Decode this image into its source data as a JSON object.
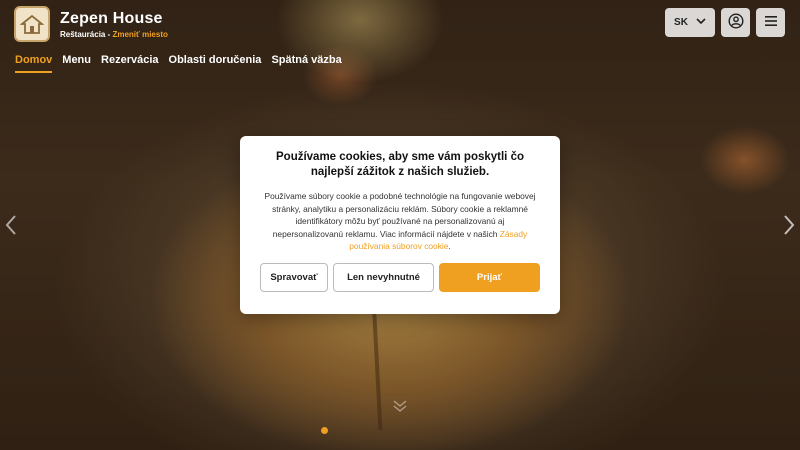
{
  "brand": {
    "name": "Zepen House",
    "subtitle": "Reštaurácia",
    "separator": " - ",
    "change_city": "Zmeniť miesto",
    "logo_icon": "house-logo-icon"
  },
  "nav": {
    "items": [
      {
        "label": "Domov",
        "active": true
      },
      {
        "label": "Menu",
        "active": false
      },
      {
        "label": "Rezervácia",
        "active": false
      },
      {
        "label": "Oblasti doručenia",
        "active": false
      },
      {
        "label": "Spätná väzba",
        "active": false
      }
    ]
  },
  "header_actions": {
    "language": "SK",
    "language_icon": "chevron-down-icon",
    "account_icon": "user-icon",
    "menu_icon": "hamburger-icon"
  },
  "cookie_modal": {
    "title": "Používame cookies, aby sme vám poskytli čo najlepší zážitok z našich služieb.",
    "body": "Používame súbory cookie a podobné technológie na fungovanie webovej stránky, analytiku a personalizáciu reklám. Súbory cookie a reklamné identifikátory môžu byť používané na personalizovanú aj nepersonalizovanú reklamu. Viac informácií nájdete v našich ",
    "link": "Zásady používania súborov cookie",
    "link_suffix": ".",
    "buttons": {
      "manage": "Spravovať",
      "necessary": "Len nevyhnutné",
      "accept": "Prijať"
    }
  },
  "colors": {
    "accent": "#f0a020",
    "text_dark": "#111111"
  }
}
